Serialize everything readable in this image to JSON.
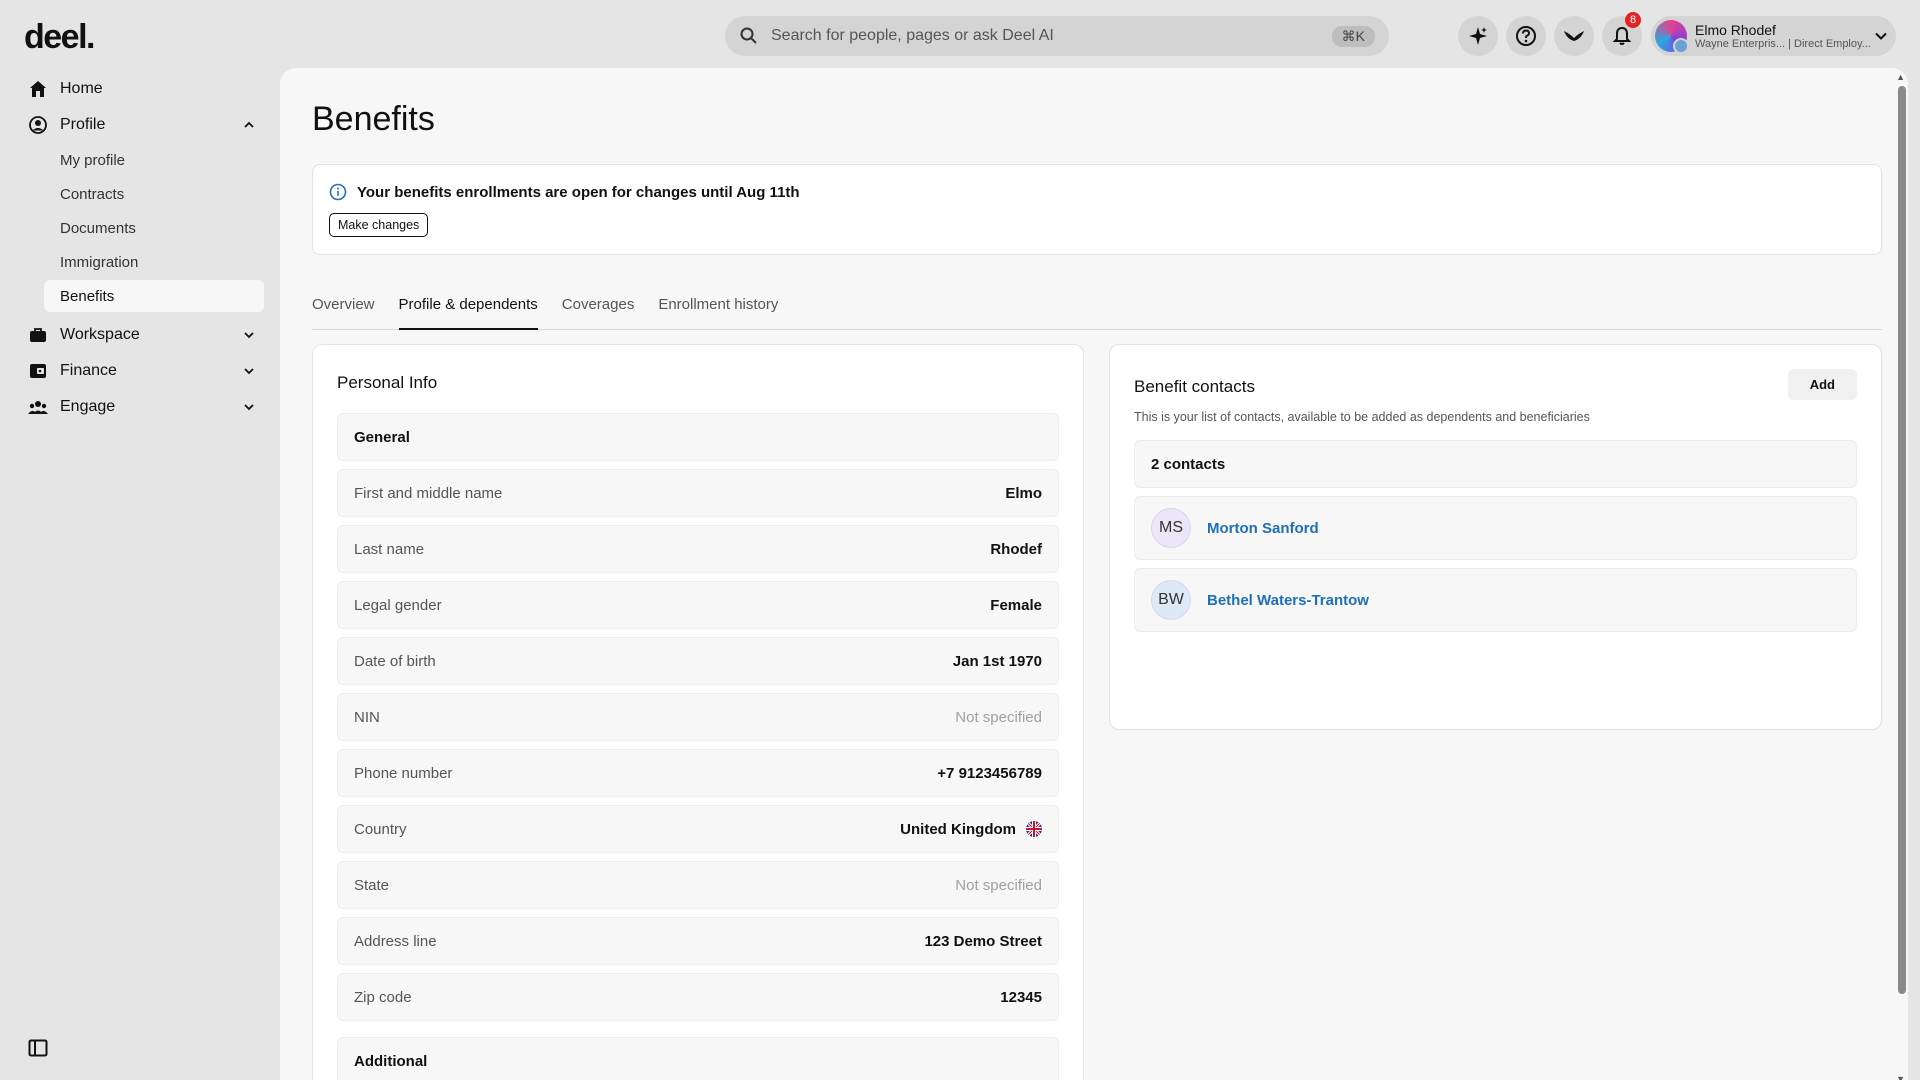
{
  "brand": {
    "logo": "deel."
  },
  "search": {
    "placeholder": "Search for people, pages or ask Deel AI",
    "shortcut": "⌘K"
  },
  "header": {
    "notifications_count": "8",
    "user": {
      "name": "Elmo Rhodef",
      "subtitle": "Wayne Enterpris... | Direct Employ..."
    }
  },
  "sidebar": {
    "home": "Home",
    "profile": "Profile",
    "profile_items": [
      "My profile",
      "Contracts",
      "Documents",
      "Immigration",
      "Benefits"
    ],
    "workspace": "Workspace",
    "finance": "Finance",
    "engage": "Engage"
  },
  "page": {
    "title": "Benefits",
    "notice": {
      "text": "Your benefits enrollments are open for changes until Aug 11th",
      "button": "Make changes"
    },
    "tabs": [
      "Overview",
      "Profile & dependents",
      "Coverages",
      "Enrollment history"
    ],
    "active_tab": "Profile & dependents"
  },
  "personal_info": {
    "title": "Personal Info",
    "general_label": "General",
    "fields": [
      {
        "label": "First and middle name",
        "value": "Elmo"
      },
      {
        "label": "Last name",
        "value": "Rhodef"
      },
      {
        "label": "Legal gender",
        "value": "Female"
      },
      {
        "label": "Date of birth",
        "value": "Jan 1st 1970"
      },
      {
        "label": "NIN",
        "value": "Not specified"
      },
      {
        "label": "Phone number",
        "value": "+7 9123456789"
      },
      {
        "label": "Country",
        "value": "United Kingdom"
      },
      {
        "label": "State",
        "value": "Not specified"
      },
      {
        "label": "Address line",
        "value": "123 Demo Street"
      },
      {
        "label": "Zip code",
        "value": "12345"
      }
    ],
    "additional_label": "Additional"
  },
  "benefit_contacts": {
    "title": "Benefit contacts",
    "add_button": "Add",
    "description": "This is your list of contacts, available to be added as dependents and beneficiaries",
    "count_label": "2 contacts",
    "contacts": [
      {
        "initials": "MS",
        "name": "Morton Sanford",
        "avatar_color": "#ece6f8"
      },
      {
        "initials": "BW",
        "name": "Bethel Waters-Trantow",
        "avatar_color": "#dde9f7"
      }
    ]
  },
  "colors": {
    "link": "#1f6fb8",
    "badge": "#e02424",
    "muted": "#a0a0a0"
  }
}
